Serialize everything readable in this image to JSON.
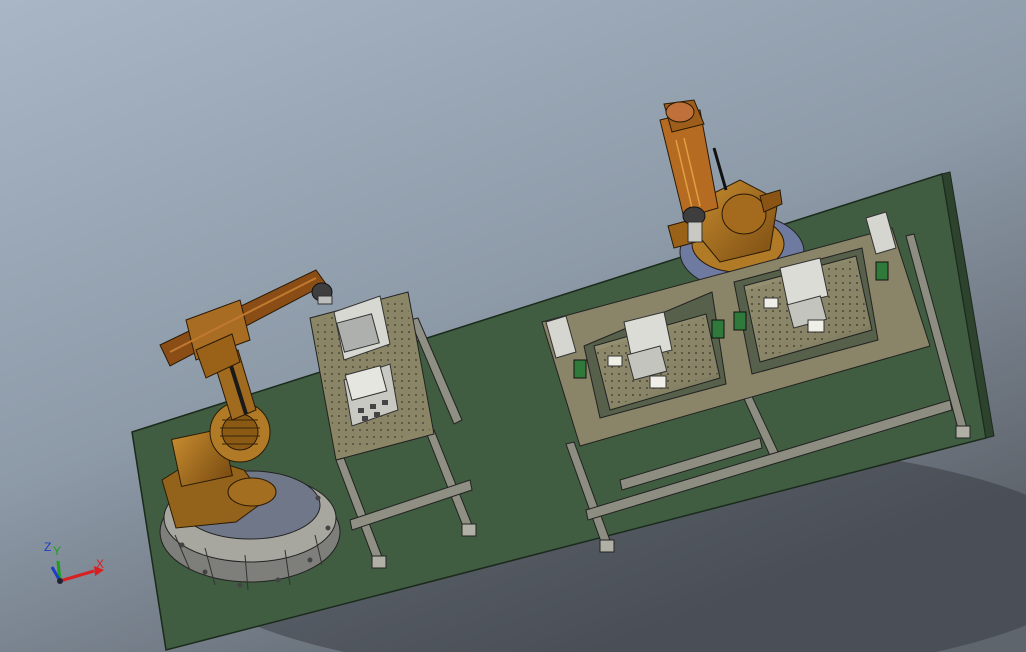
{
  "triad": {
    "z_label": "Z",
    "y_label": "Y",
    "x_label": "X",
    "x_color": "#d82020",
    "y_color": "#1aa01a",
    "z_color": "#1a3cc8"
  },
  "colors": {
    "background_top": "#9aa8b8",
    "background_bottom": "#6a7078",
    "floor": "#3f5c40",
    "robot_body": "#a26b1c",
    "robot_dark": "#5a3a10",
    "base_plate": "#8d8d88",
    "frame_steel": "#9a9a8c",
    "table_top": "#8c8c6c"
  }
}
